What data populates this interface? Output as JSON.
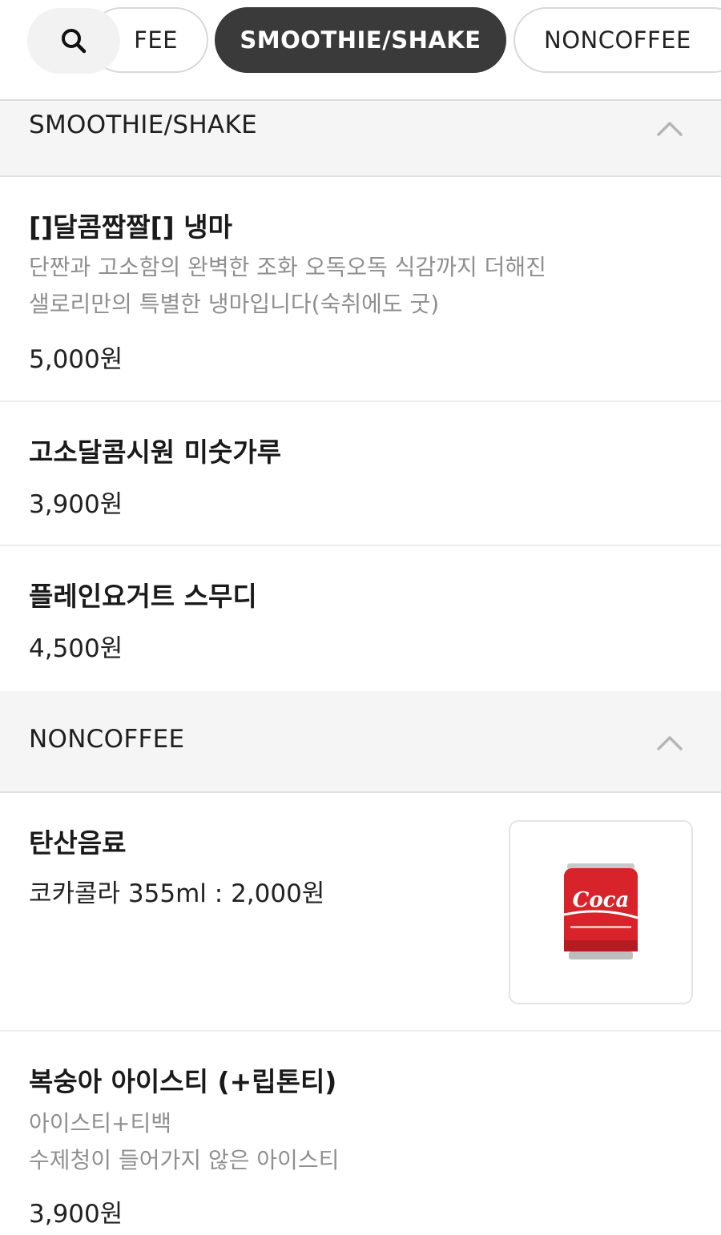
{
  "tabs": {
    "partial_label": "FEE",
    "active_label": "SMOOTHIE/SHAKE",
    "next_label": "NONCOFFEE"
  },
  "sections": [
    {
      "title": "SMOOTHIE/SHAKE",
      "items": [
        {
          "name": "[]달콤짭짤[] 냉마",
          "desc_line1": "단짠과 고소함의 완벽한 조화 오독오독 식감까지 더해진",
          "desc_line2": "샐로리만의 특별한 냉마입니다(숙취에도 굿)",
          "price": "5,000원"
        },
        {
          "name": "고소달콤시원 미숫가루",
          "price": "3,900원"
        },
        {
          "name": "플레인요거트 스무디",
          "price": "4,500원"
        }
      ]
    },
    {
      "title": "NONCOFFEE",
      "items": [
        {
          "name": "탄산음료",
          "sub": "코카콜라 355ml : 2,000원",
          "image_label": "Coca-Cola"
        },
        {
          "name": "복숭아 아이스티 (+립톤티)",
          "desc_line1": "아이스티+티백",
          "desc_line2": "수제청이 들어가지 않은 아이스티",
          "price": "3,900원"
        }
      ]
    }
  ],
  "colors": {
    "active_pill": "#3a3a3a",
    "section_bg": "#f5f5f5",
    "desc_gray": "#8f8f8f",
    "can_red": "#d8232a"
  },
  "icons": {
    "search": "search-icon",
    "collapse": "chevron-up-icon"
  }
}
